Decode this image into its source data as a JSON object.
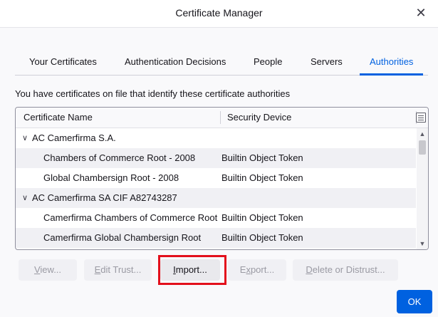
{
  "window": {
    "title": "Certificate Manager",
    "close_glyph": "✕"
  },
  "tabs": [
    {
      "label": "Your Certificates",
      "selected": false
    },
    {
      "label": "Authentication Decisions",
      "selected": false
    },
    {
      "label": "People",
      "selected": false
    },
    {
      "label": "Servers",
      "selected": false
    },
    {
      "label": "Authorities",
      "selected": true
    }
  ],
  "description": "You have certificates on file that identify these certificate authorities",
  "table": {
    "columns": [
      "Certificate Name",
      "Security Device"
    ],
    "rows": [
      {
        "type": "group",
        "name": "AC Camerfirma S.A.",
        "device": "",
        "expanded": true
      },
      {
        "type": "item",
        "name": "Chambers of Commerce Root - 2008",
        "device": "Builtin Object Token"
      },
      {
        "type": "item",
        "name": "Global Chambersign Root - 2008",
        "device": "Builtin Object Token"
      },
      {
        "type": "group",
        "name": "AC Camerfirma SA CIF A82743287",
        "device": "",
        "expanded": true
      },
      {
        "type": "item",
        "name": "Camerfirma Chambers of Commerce Root",
        "device": "Builtin Object Token"
      },
      {
        "type": "item",
        "name": "Camerfirma Global Chambersign Root",
        "device": "Builtin Object Token"
      }
    ]
  },
  "buttons": {
    "view": {
      "prefix": "",
      "mnemonic": "V",
      "suffix": "iew...",
      "enabled": false
    },
    "edit_trust": {
      "prefix": "",
      "mnemonic": "E",
      "suffix": "dit Trust...",
      "enabled": false
    },
    "import": {
      "prefix": "",
      "mnemonic": "I",
      "suffix": "mport...",
      "enabled": true
    },
    "export": {
      "prefix": "",
      "mnemonic": "x",
      "suffix": "port...",
      "enabled": false,
      "full_prefix": "E"
    },
    "delete": {
      "prefix": "",
      "mnemonic": "D",
      "suffix": "elete or Distrust...",
      "enabled": false
    }
  },
  "ok_label": "OK",
  "colors": {
    "accent": "#0061e0",
    "highlight": "#e3101c"
  }
}
